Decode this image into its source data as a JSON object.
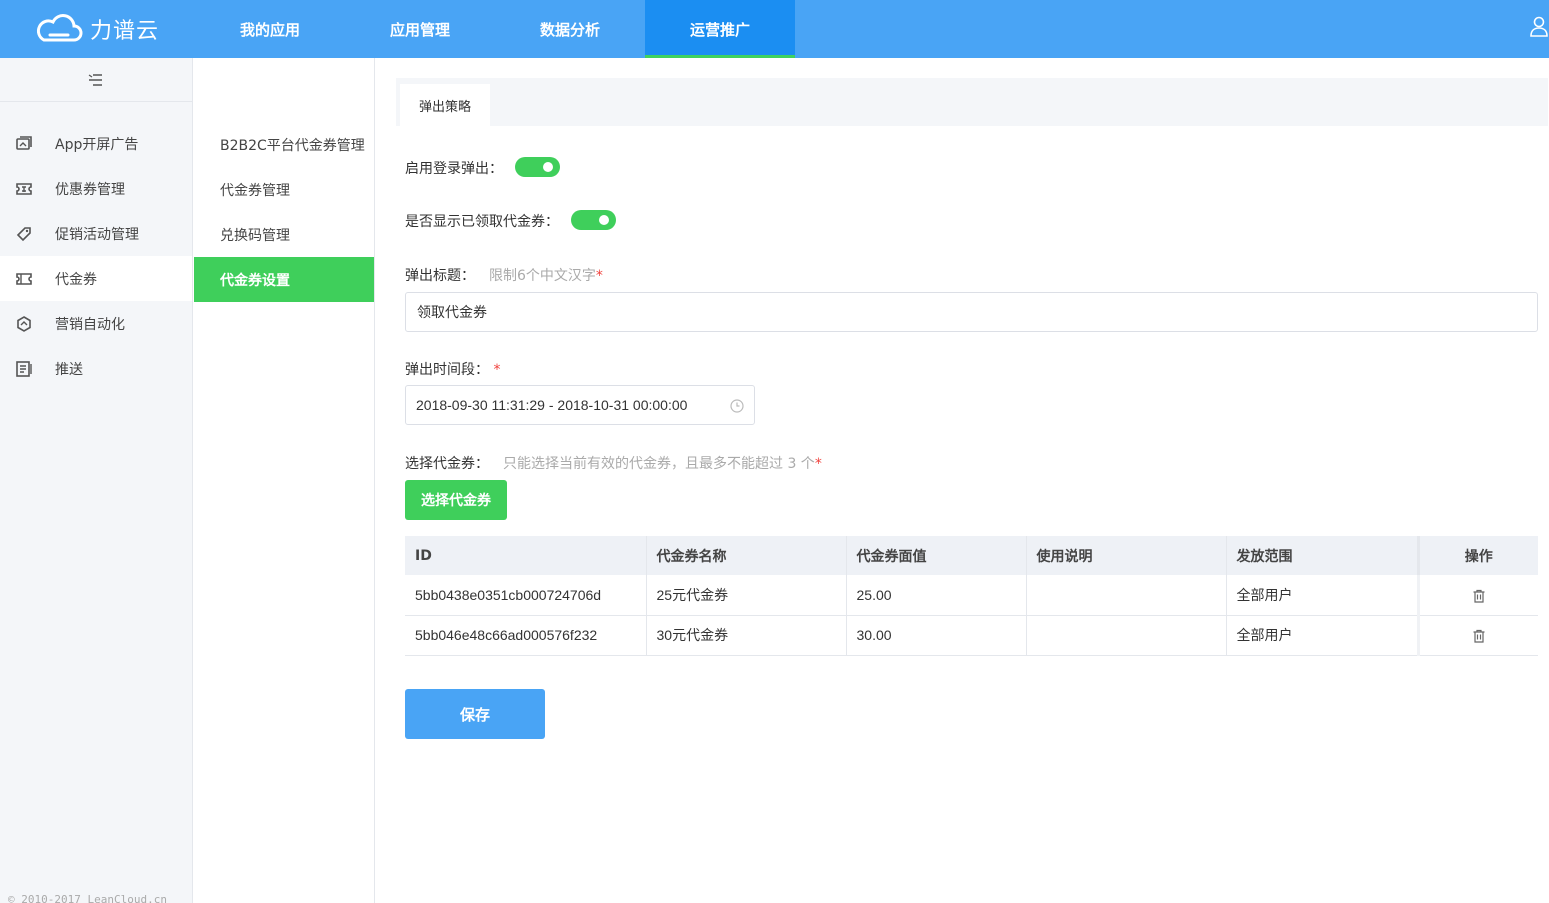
{
  "app": {
    "brand": "力谱云"
  },
  "topnav": {
    "items": [
      {
        "label": "我的应用"
      },
      {
        "label": "应用管理"
      },
      {
        "label": "数据分析"
      },
      {
        "label": "运营推广"
      }
    ],
    "active_index": 3
  },
  "sidebar": {
    "items": [
      {
        "label": "App开屏广告",
        "icon": "image-icon"
      },
      {
        "label": "优惠券管理",
        "icon": "ticket-icon"
      },
      {
        "label": "促销活动管理",
        "icon": "tag-icon"
      },
      {
        "label": "代金券",
        "icon": "voucher-icon"
      },
      {
        "label": "营销自动化",
        "icon": "automation-icon"
      },
      {
        "label": "推送",
        "icon": "push-icon"
      }
    ],
    "active_index": 3,
    "copyright": "© 2010-2017 LeanCloud.cn"
  },
  "subnav": {
    "items": [
      {
        "label": "B2B2C平台代金券管理"
      },
      {
        "label": "代金券管理"
      },
      {
        "label": "兑换码管理"
      },
      {
        "label": "代金券设置"
      }
    ],
    "active_index": 3
  },
  "tabs": {
    "active_label": "弹出策略"
  },
  "form": {
    "login_popup_label": "启用登录弹出：",
    "show_claimed_label": "是否显示已领取代金券：",
    "popup_title_label": "弹出标题：",
    "popup_title_hint": "限制6个中文汉字",
    "popup_title_value": "领取代金券",
    "popup_period_label": "弹出时间段：",
    "popup_period_value": "2018-09-30 11:31:29 - 2018-10-31 00:00:00",
    "select_voucher_label": "选择代金券：",
    "select_voucher_hint": "只能选择当前有效的代金券，且最多不能超过 3 个",
    "required_mark": "*",
    "select_voucher_button": "选择代金券",
    "save_button": "保存"
  },
  "table": {
    "headers": [
      "ID",
      "代金券名称",
      "代金券面值",
      "使用说明",
      "发放范围",
      "操作"
    ],
    "rows": [
      {
        "id": "5bb0438e0351cb000724706d",
        "name": "25元代金券",
        "value": "25.00",
        "desc": "",
        "scope": "全部用户"
      },
      {
        "id": "5bb046e48c66ad000576f232",
        "name": "30元代金券",
        "value": "30.00",
        "desc": "",
        "scope": "全部用户"
      }
    ]
  },
  "colors": {
    "topbar": "#49a4f5",
    "active_nav": "#1b8ef2",
    "green": "#3fcf5b",
    "required": "#f0413c"
  }
}
